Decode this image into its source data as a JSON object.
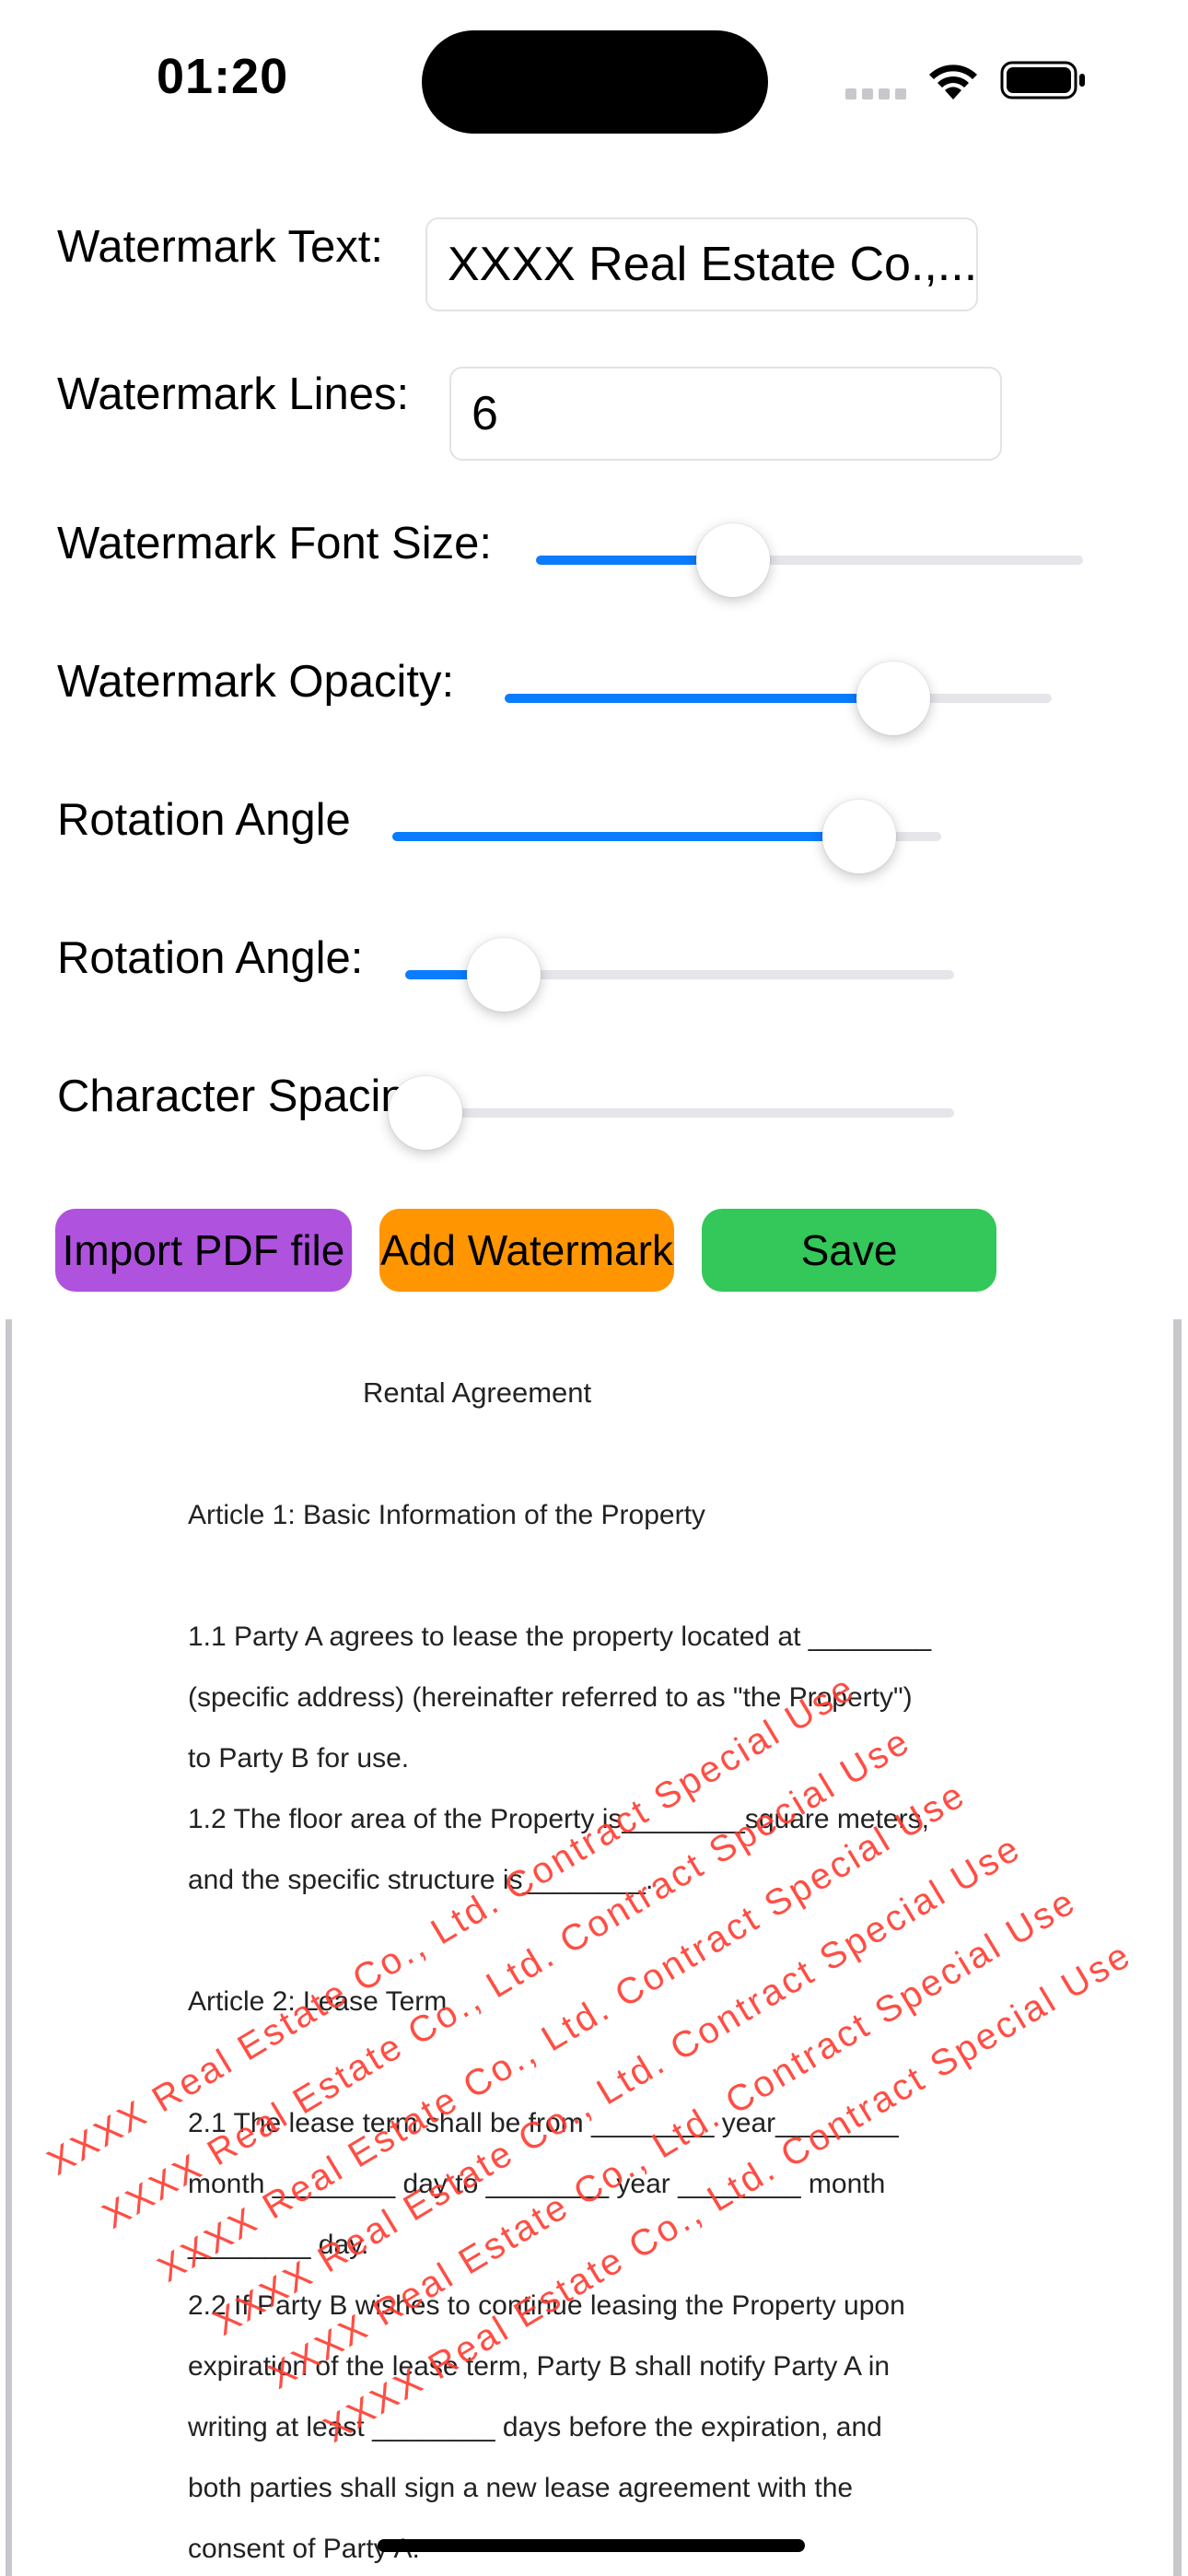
{
  "status_bar": {
    "time": "01:20",
    "icons": [
      "cellular-signal-icon",
      "wifi-icon",
      "battery-icon"
    ]
  },
  "form": {
    "watermark_text": {
      "label": "Watermark Text:",
      "value": "XXXX Real Estate Co.,..."
    },
    "watermark_lines": {
      "label": "Watermark Lines:",
      "value": "6"
    },
    "font_size": {
      "label": "Watermark Font Size:",
      "level": 0.36
    },
    "opacity": {
      "label": "Watermark Opacity:",
      "level": 0.71
    },
    "rotation_1": {
      "label": "Rotation Angle",
      "level": 0.85
    },
    "rotation_2": {
      "label": "Rotation Angle:",
      "level": 0.18
    },
    "spacing": {
      "label": "Character Spacing:",
      "level": 0.0
    }
  },
  "buttons": {
    "import": "Import PDF file",
    "add_watermark": "Add Watermark",
    "save": "Save"
  },
  "colors": {
    "accent": "#0a7cff",
    "import_button": "#af52de",
    "watermark_button": "#ff9500",
    "save_button": "#34c759",
    "watermark_text": "#ff3b30"
  },
  "pdf": {
    "title": "Rental Agreement",
    "lines": [
      "Article 1: Basic Information of the Property",
      "1.1 Party A agrees to lease the property located at ________",
      "(specific address) (hereinafter referred to as \"the Property\")",
      "to Party B for use.",
      "1.2 The floor area of the Property is________square meters,",
      "and the specific structure is________.",
      "Article 2: Lease Term",
      "2.1 The lease term shall be from ________ year________",
      "month ________ day to ________ year ________ month",
      "________ day.",
      "2.2 If Party B wishes to continue leasing the Property upon",
      "expiration of the lease term, Party B shall notify Party A in",
      "writing at least ________ days before the expiration, and",
      "both parties shall sign a new lease agreement with the",
      "consent of Party A."
    ],
    "watermark": "XXXX Real Estate Co., Ltd. Contract Special Use"
  }
}
